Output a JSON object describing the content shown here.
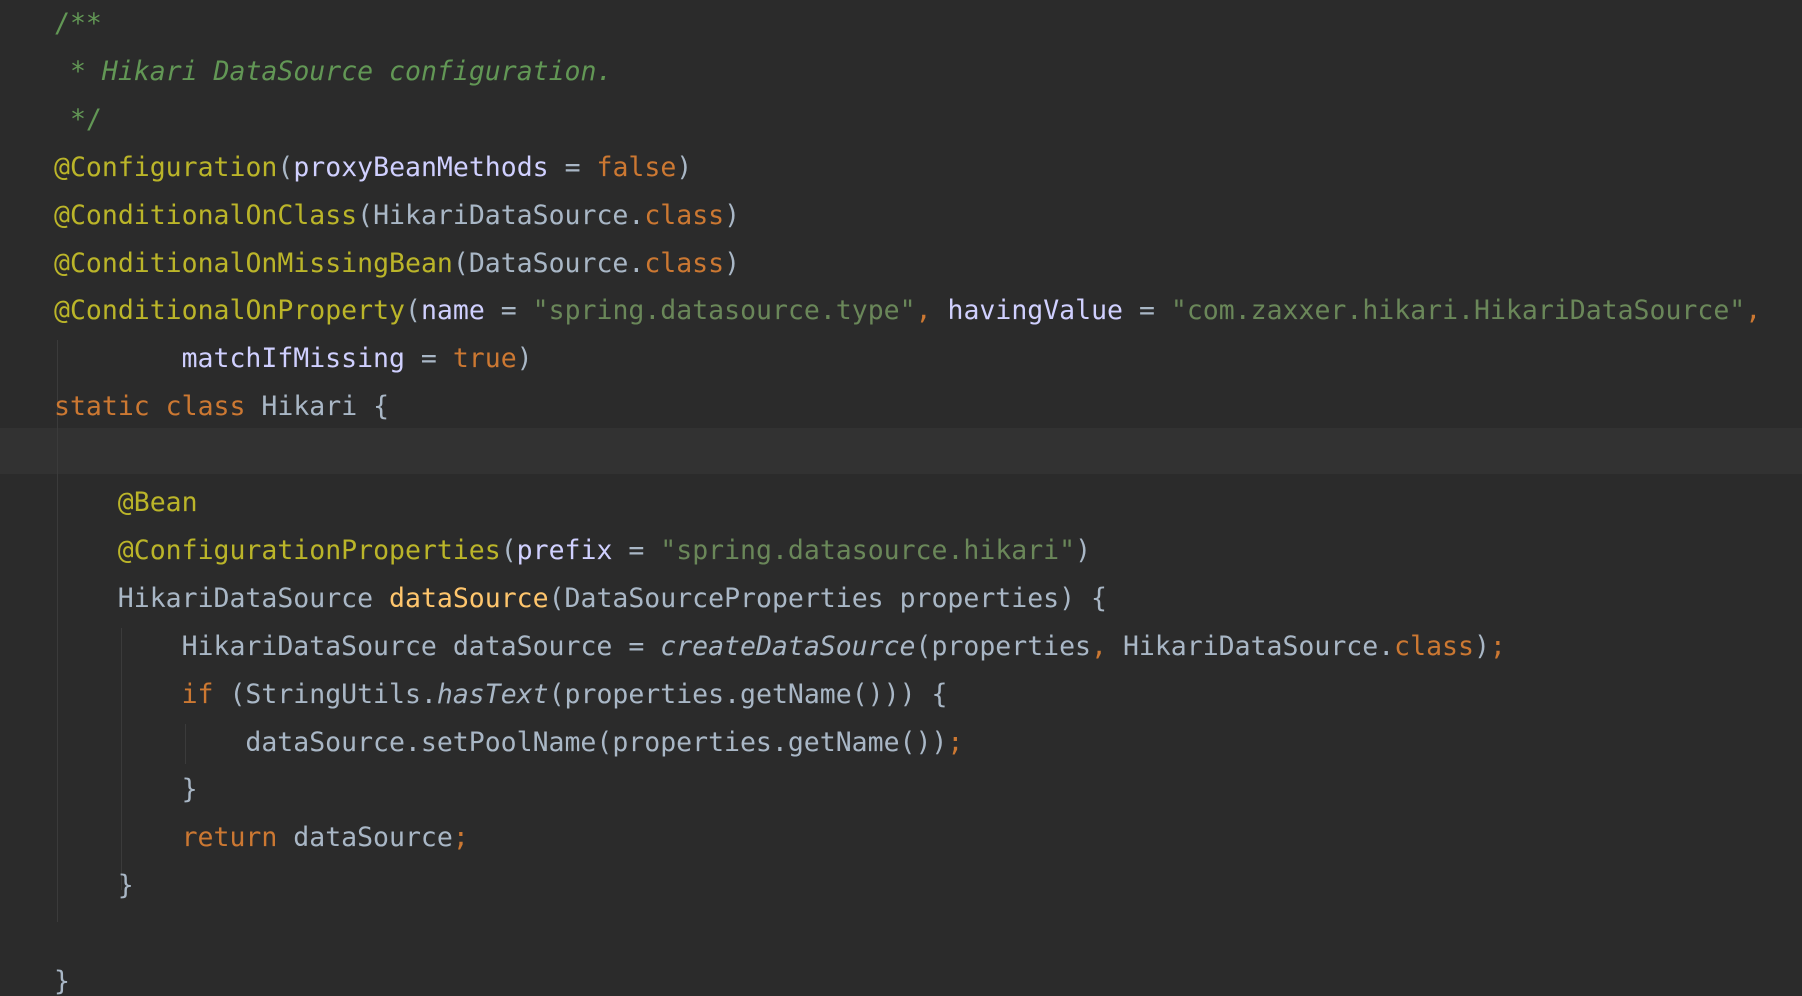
{
  "editor": {
    "lines": [
      {
        "indent": 0,
        "tokens": [
          {
            "t": "/**",
            "k": "com"
          }
        ]
      },
      {
        "indent": 0,
        "tokens": [
          {
            "t": " * ",
            "k": "com"
          },
          {
            "t": "Hikari DataSource configuration.",
            "k": "doc"
          }
        ]
      },
      {
        "indent": 0,
        "tokens": [
          {
            "t": " */",
            "k": "com"
          }
        ]
      },
      {
        "indent": 0,
        "tokens": [
          {
            "t": "@Configuration",
            "k": "ann"
          },
          {
            "t": "(",
            "k": "p"
          },
          {
            "t": "proxyBeanMethods",
            "k": "par"
          },
          {
            "t": " = ",
            "k": "p"
          },
          {
            "t": "false",
            "k": "kw"
          },
          {
            "t": ")",
            "k": "p"
          }
        ]
      },
      {
        "indent": 0,
        "tokens": [
          {
            "t": "@ConditionalOnClass",
            "k": "ann"
          },
          {
            "t": "(HikariDataSource.",
            "k": "p"
          },
          {
            "t": "class",
            "k": "kw"
          },
          {
            "t": ")",
            "k": "p"
          }
        ]
      },
      {
        "indent": 0,
        "tokens": [
          {
            "t": "@ConditionalOnMissingBean",
            "k": "ann"
          },
          {
            "t": "(DataSource.",
            "k": "p"
          },
          {
            "t": "class",
            "k": "kw"
          },
          {
            "t": ")",
            "k": "p"
          }
        ]
      },
      {
        "indent": 0,
        "tokens": [
          {
            "t": "@ConditionalOnProperty",
            "k": "ann"
          },
          {
            "t": "(",
            "k": "p"
          },
          {
            "t": "name",
            "k": "par"
          },
          {
            "t": " = ",
            "k": "p"
          },
          {
            "t": "\"spring.datasource.type\"",
            "k": "str"
          },
          {
            "t": ", ",
            "k": "kw"
          },
          {
            "t": "havingValue",
            "k": "par"
          },
          {
            "t": " = ",
            "k": "p"
          },
          {
            "t": "\"com.zaxxer.hikari.HikariDataSource\"",
            "k": "str"
          },
          {
            "t": ",",
            "k": "kw"
          }
        ]
      },
      {
        "indent": 8,
        "tokens": [
          {
            "t": "matchIfMissing",
            "k": "par"
          },
          {
            "t": " = ",
            "k": "p"
          },
          {
            "t": "true",
            "k": "kw"
          },
          {
            "t": ")",
            "k": "p"
          }
        ]
      },
      {
        "indent": 0,
        "tokens": [
          {
            "t": "static class ",
            "k": "kw"
          },
          {
            "t": "Hikari {",
            "k": "p"
          }
        ]
      },
      {
        "indent": 0,
        "tokens": []
      },
      {
        "indent": 4,
        "tokens": [
          {
            "t": "@Bean",
            "k": "ann"
          }
        ]
      },
      {
        "indent": 4,
        "tokens": [
          {
            "t": "@ConfigurationProperties",
            "k": "ann"
          },
          {
            "t": "(",
            "k": "p"
          },
          {
            "t": "prefix",
            "k": "par"
          },
          {
            "t": " = ",
            "k": "p"
          },
          {
            "t": "\"spring.datasource.hikari\"",
            "k": "str"
          },
          {
            "t": ")",
            "k": "p"
          }
        ]
      },
      {
        "indent": 4,
        "tokens": [
          {
            "t": "HikariDataSource ",
            "k": "p"
          },
          {
            "t": "dataSource",
            "k": "fn"
          },
          {
            "t": "(DataSourceProperties properties) {",
            "k": "p"
          }
        ]
      },
      {
        "indent": 8,
        "tokens": [
          {
            "t": "HikariDataSource dataSource = ",
            "k": "p"
          },
          {
            "t": "createDataSource",
            "k": "it"
          },
          {
            "t": "(properties",
            "k": "p"
          },
          {
            "t": ", ",
            "k": "kw"
          },
          {
            "t": "HikariDataSource.",
            "k": "p"
          },
          {
            "t": "class",
            "k": "kw"
          },
          {
            "t": ")",
            "k": "p"
          },
          {
            "t": ";",
            "k": "kw"
          }
        ]
      },
      {
        "indent": 8,
        "tokens": [
          {
            "t": "if ",
            "k": "kw"
          },
          {
            "t": "(StringUtils.",
            "k": "p"
          },
          {
            "t": "hasText",
            "k": "it"
          },
          {
            "t": "(properties.getName())) {",
            "k": "p"
          }
        ]
      },
      {
        "indent": 12,
        "tokens": [
          {
            "t": "dataSource.setPoolName(properties.getName())",
            "k": "p"
          },
          {
            "t": ";",
            "k": "kw"
          }
        ]
      },
      {
        "indent": 8,
        "tokens": [
          {
            "t": "}",
            "k": "p"
          }
        ]
      },
      {
        "indent": 8,
        "tokens": [
          {
            "t": "return ",
            "k": "kw"
          },
          {
            "t": "dataSource",
            "k": "p"
          },
          {
            "t": ";",
            "k": "kw"
          }
        ]
      },
      {
        "indent": 4,
        "tokens": [
          {
            "t": "}",
            "k": "p"
          }
        ]
      },
      {
        "indent": 0,
        "tokens": []
      },
      {
        "indent": 0,
        "tokens": [
          {
            "t": "}",
            "k": "p"
          }
        ]
      }
    ]
  },
  "colors": {
    "background": "#2b2b2b",
    "caret_line": "#323232",
    "plain": "#a9b7c6",
    "comment": "#629755",
    "annotation": "#bbb529",
    "keyword": "#cc7832",
    "string": "#6a8759",
    "parameter": "#d0d0ff",
    "method_declaration": "#ffc66d"
  }
}
